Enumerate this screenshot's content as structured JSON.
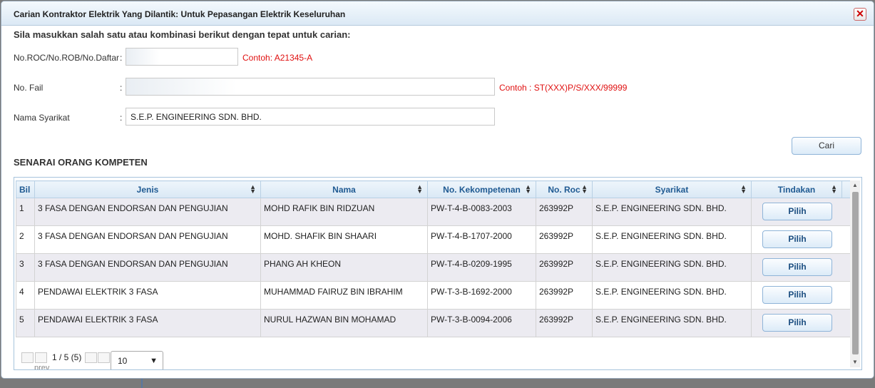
{
  "dialog": {
    "title": "Carian Kontraktor Elektrik Yang Dilantik: Untuk Pepasangan Elektrik Keseluruhan",
    "close_icon": "close-icon"
  },
  "form": {
    "instruction": "Sila masukkan salah satu atau kombinasi berikut dengan tepat untuk carian:",
    "roc_label": "No.ROC/No.ROB/No.Daftar",
    "roc_colon": ":",
    "roc_value": "",
    "roc_hint": "Contoh: A21345-A",
    "fail_label": "No. Fail",
    "fail_colon": ":",
    "fail_value": "",
    "fail_hint": "Contoh : ST(XXX)P/S/XXX/99999",
    "company_label": "Nama Syarikat",
    "company_colon": ":",
    "company_value": "S.E.P. ENGINEERING SDN. BHD.",
    "search_button": "Cari"
  },
  "list": {
    "section_title": "SENARAI ORANG KOMPETEN",
    "columns": [
      "Bil",
      "Jenis",
      "Nama",
      "No. Kekompetenan",
      "No. Roc",
      "Syarikat",
      "Tindakan"
    ],
    "rows": [
      {
        "bil": "1",
        "jenis": "3 FASA DENGAN ENDORSAN DAN PENGUJIAN",
        "nama": "MOHD RAFIK BIN RIDZUAN",
        "kompetenan": "PW-T-4-B-0083-2003",
        "roc": "263992P",
        "syarikat": "S.E.P. ENGINEERING SDN. BHD.",
        "action": "Pilih"
      },
      {
        "bil": "2",
        "jenis": "3 FASA DENGAN ENDORSAN DAN PENGUJIAN",
        "nama": "MOHD. SHAFIK BIN SHAARI",
        "kompetenan": "PW-T-4-B-1707-2000",
        "roc": "263992P",
        "syarikat": "S.E.P. ENGINEERING SDN. BHD.",
        "action": "Pilih"
      },
      {
        "bil": "3",
        "jenis": "3 FASA DENGAN ENDORSAN DAN PENGUJIAN",
        "nama": "PHANG AH KHEON",
        "kompetenan": "PW-T-4-B-0209-1995",
        "roc": "263992P",
        "syarikat": "S.E.P. ENGINEERING SDN. BHD.",
        "action": "Pilih"
      },
      {
        "bil": "4",
        "jenis": "PENDAWAI ELEKTRIK 3 FASA",
        "nama": "MUHAMMAD FAIRUZ BIN IBRAHIM",
        "kompetenan": "PW-T-3-B-1692-2000",
        "roc": "263992P",
        "syarikat": "S.E.P. ENGINEERING SDN. BHD.",
        "action": "Pilih"
      },
      {
        "bil": "5",
        "jenis": "PENDAWAI ELEKTRIK 3 FASA",
        "nama": "NURUL HAZWAN BIN MOHAMAD",
        "kompetenan": "PW-T-3-B-0094-2006",
        "roc": "263992P",
        "syarikat": "S.E.P. ENGINEERING SDN. BHD.",
        "action": "Pilih"
      }
    ],
    "pager": {
      "page_info": "1 / 5 (5)",
      "prev_text": "prev",
      "page_size": "10"
    }
  },
  "colors": {
    "header_text": "#1f5a92",
    "hint_red": "#e01010",
    "odd_row": "#ecebf1"
  }
}
